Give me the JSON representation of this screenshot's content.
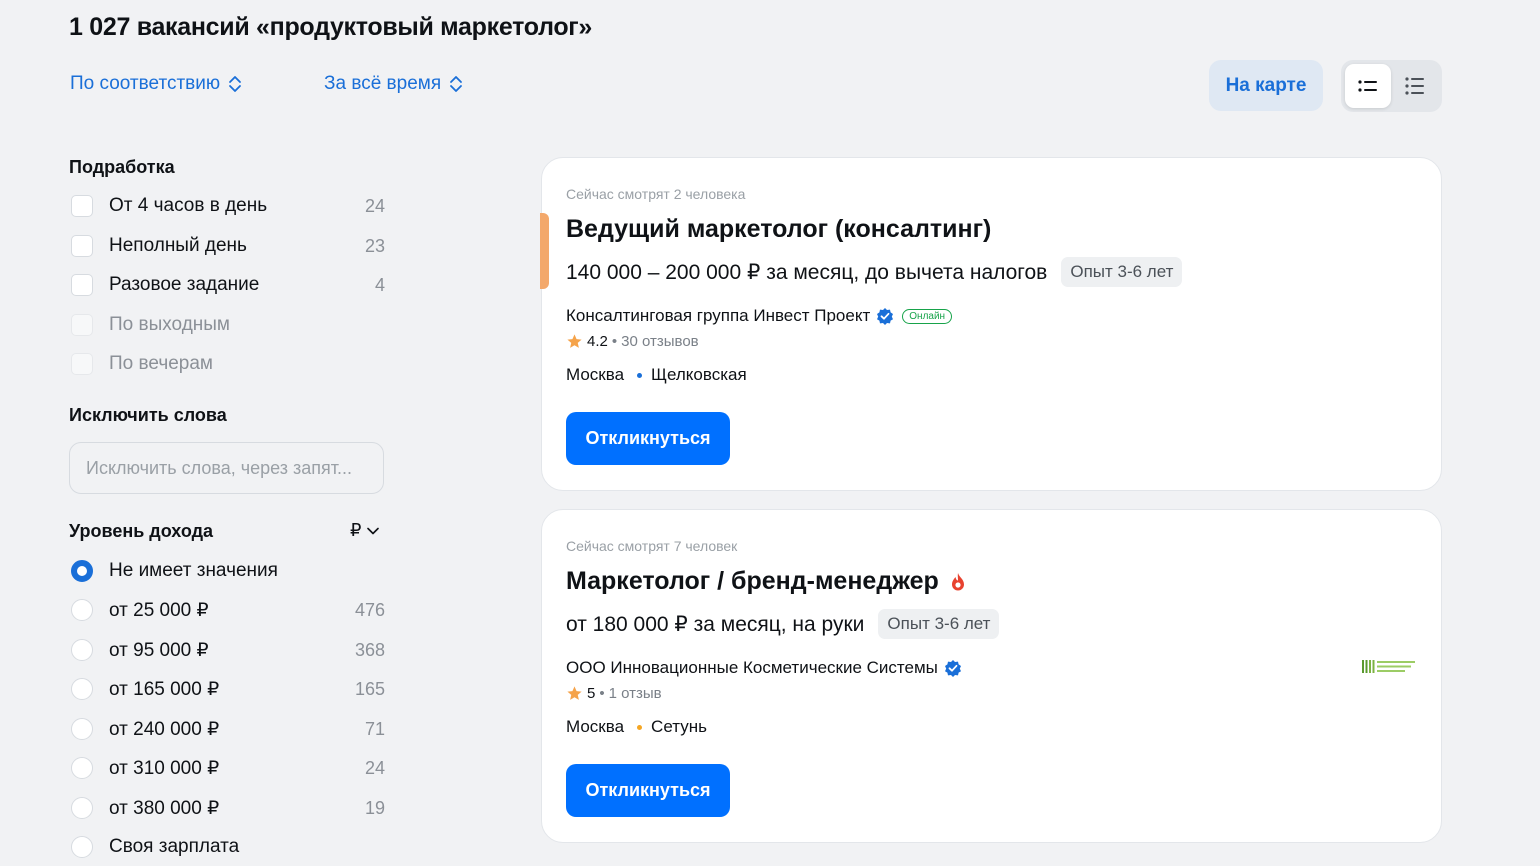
{
  "page_title": "1 027 вакансий «продуктовый маркетолог»",
  "sort": {
    "relevance_label": "По соответствию",
    "period_label": "За всё время"
  },
  "map_button_label": "На карте",
  "part_time": {
    "title": "Подработка",
    "options": [
      {
        "label": "От 4 часов в день",
        "count": "24",
        "enabled": true
      },
      {
        "label": "Неполный день",
        "count": "23",
        "enabled": true
      },
      {
        "label": "Разовое задание",
        "count": "4",
        "enabled": true
      },
      {
        "label": "По выходным",
        "count": "",
        "enabled": false
      },
      {
        "label": "По вечерам",
        "count": "",
        "enabled": false
      }
    ]
  },
  "exclude_words": {
    "title": "Исключить слова",
    "placeholder": "Исключить слова, через запят..."
  },
  "income": {
    "title": "Уровень дохода",
    "currency": "₽",
    "options": [
      {
        "label": "Не имеет значения",
        "count": "",
        "checked": true
      },
      {
        "label": "от 25 000 ₽",
        "count": "476",
        "checked": false
      },
      {
        "label": "от 95 000 ₽",
        "count": "368",
        "checked": false
      },
      {
        "label": "от 165 000 ₽",
        "count": "165",
        "checked": false
      },
      {
        "label": "от 240 000 ₽",
        "count": "71",
        "checked": false
      },
      {
        "label": "от 310 000 ₽",
        "count": "24",
        "checked": false
      },
      {
        "label": "от 380 000 ₽",
        "count": "19",
        "checked": false
      },
      {
        "label": "Своя зарплата",
        "count": "",
        "checked": false
      }
    ]
  },
  "vacancies": [
    {
      "viewers": "Сейчас смотрят 2 человека",
      "title": "Ведущий маркетолог (консалтинг)",
      "salary": "140 000 – 200 000 ₽ за месяц, до вычета налогов",
      "experience": "Опыт 3-6 лет",
      "company": "Консалтинговая группа Инвест Проект",
      "online_badge": "Онлайн",
      "rating": "4.2",
      "reviews": "30 отзывов",
      "city": "Москва",
      "metro": "Щелковская",
      "metro_color": "#1a6fd8",
      "respond_label": "Откликнуться"
    },
    {
      "viewers": "Сейчас смотрят 7 человек",
      "title": "Маркетолог / бренд-менеджер",
      "salary": "от 180 000 ₽ за месяц, на руки",
      "experience": "Опыт 3-6 лет",
      "company": "ООО Инновационные Косметические Системы",
      "rating": "5",
      "reviews": "1 отзыв",
      "city": "Москва",
      "metro": "Сетунь",
      "metro_color": "#f5a623",
      "respond_label": "Откликнуться"
    }
  ],
  "colors": {
    "accent": "#0070ff",
    "link": "#1a6fd8",
    "verified": "#1a6fd8",
    "hot": "#e8422f",
    "star": "#f5a34a"
  }
}
